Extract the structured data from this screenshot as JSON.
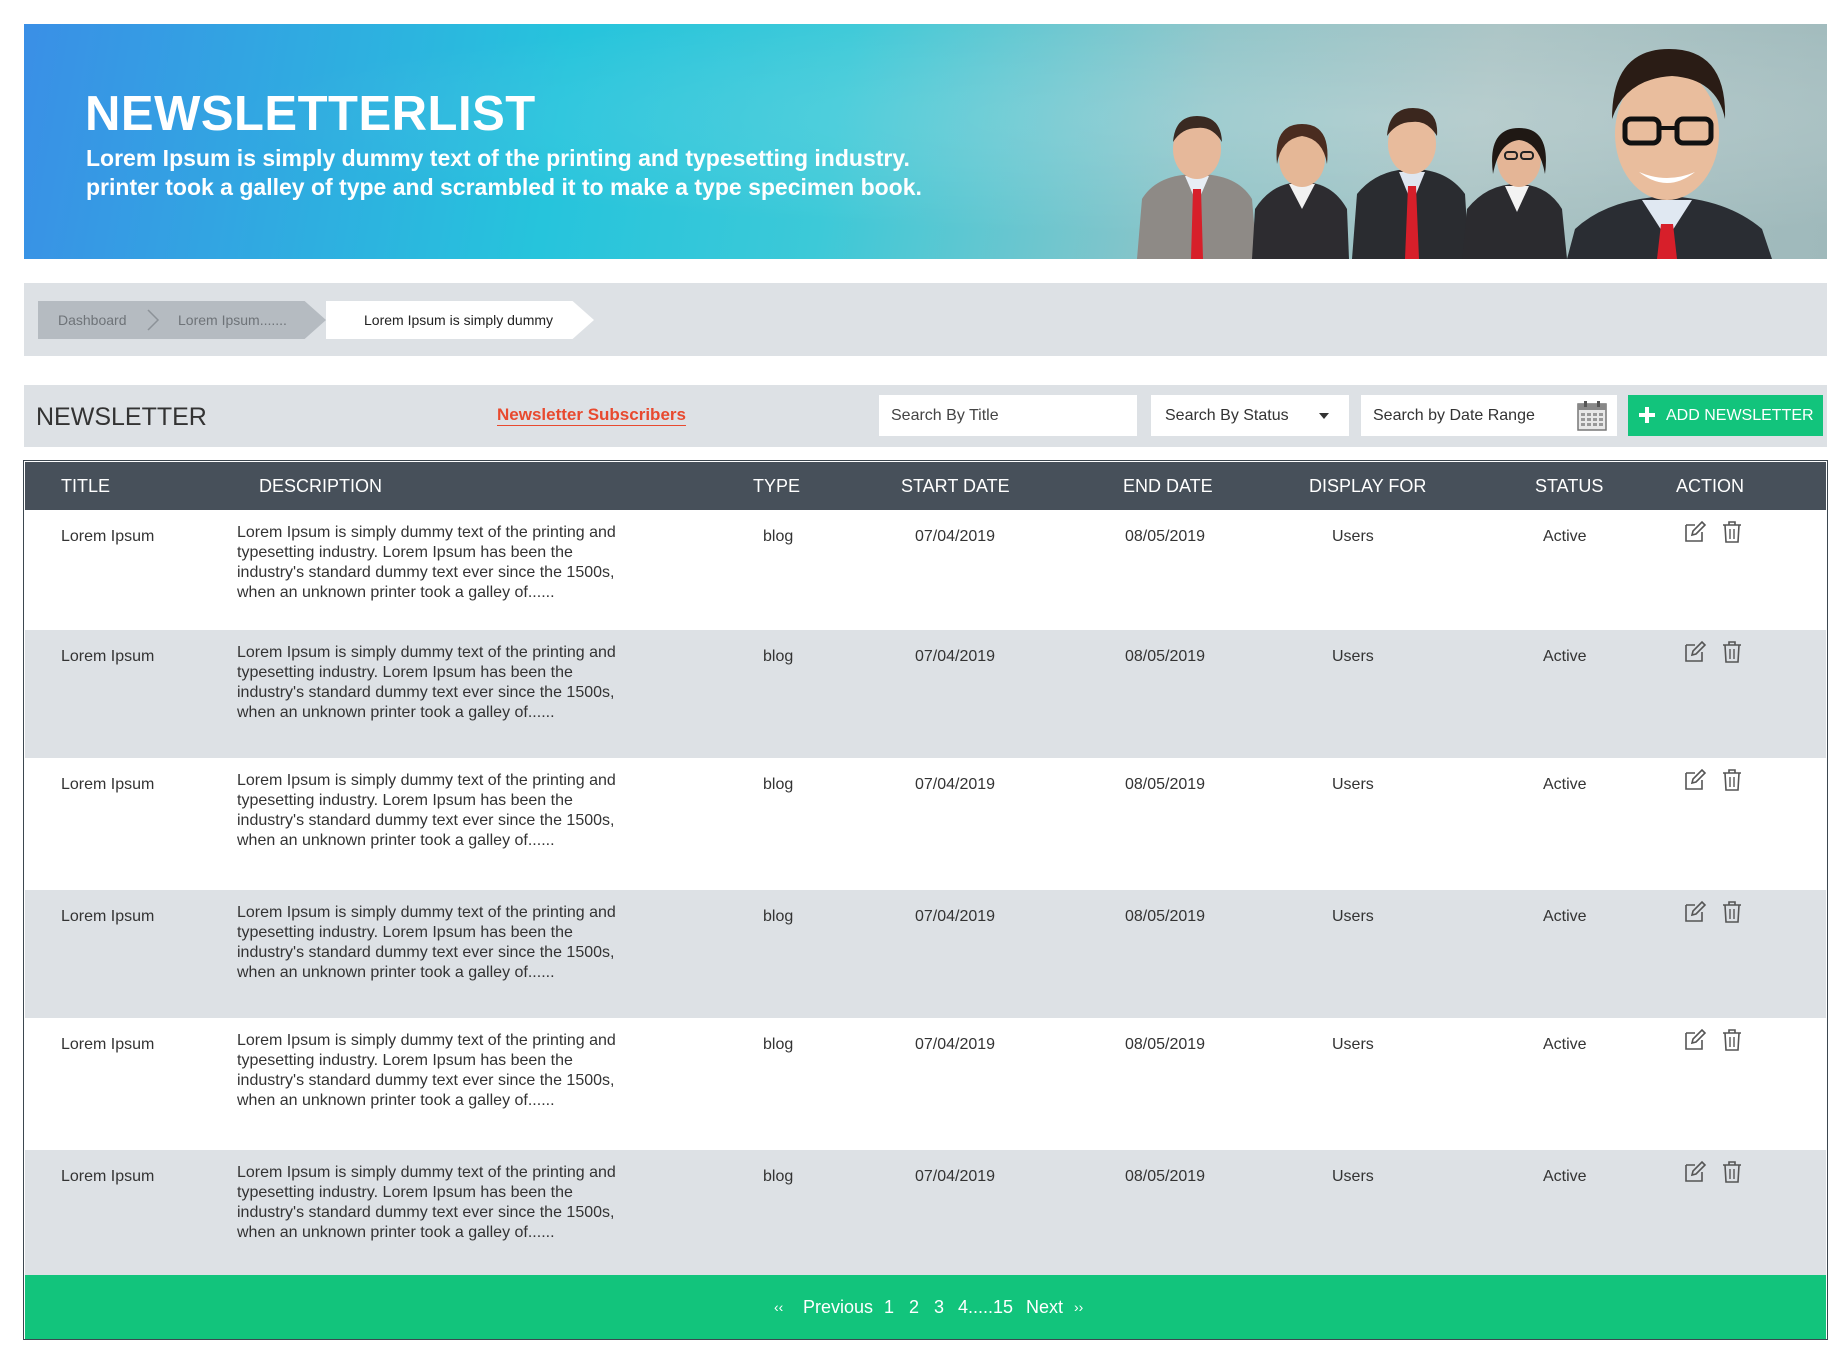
{
  "banner": {
    "title": "NEWSLETTERLIST",
    "subtitle_line1": "Lorem Ipsum is simply dummy text of the printing and typesetting industry.",
    "subtitle_line2": "printer took a galley of type and scrambled it to make a type specimen book."
  },
  "breadcrumb": {
    "items": [
      "Dashboard",
      "Lorem Ipsum.......",
      "Lorem Ipsum is simply dummy text"
    ]
  },
  "toolbar": {
    "title": "NEWSLETTER",
    "subscribers_link": "Newsletter Subscribers",
    "search_title_placeholder": "Search By Title",
    "search_status_value": "Search By Status",
    "search_date_placeholder": "Search by Date Range",
    "add_label": "ADD NEWSLETTER"
  },
  "table": {
    "columns": [
      "TITLE",
      "DESCRIPTION",
      "TYPE",
      "START DATE",
      "END DATE",
      "DISPLAY FOR",
      "STATUS",
      "ACTION"
    ],
    "rows": [
      {
        "title": "Lorem Ipsum",
        "desc": [
          "Lorem Ipsum is simply dummy text of the printing and",
          "typesetting industry. Lorem Ipsum has been the",
          "industry's standard dummy text ever since the 1500s,",
          "when an unknown printer took a galley of......"
        ],
        "type": "blog",
        "start": "07/04/2019",
        "end": "08/05/2019",
        "display": "Users",
        "status": "Active"
      },
      {
        "title": "Lorem Ipsum",
        "desc": [
          "Lorem Ipsum is simply dummy text of the printing and",
          "typesetting industry. Lorem Ipsum has been the",
          "industry's standard dummy text ever since the 1500s,",
          "when an unknown printer took a galley of......"
        ],
        "type": "blog",
        "start": "07/04/2019",
        "end": "08/05/2019",
        "display": "Users",
        "status": "Active"
      },
      {
        "title": "Lorem Ipsum",
        "desc": [
          "Lorem Ipsum is simply dummy text of the printing and",
          "typesetting industry. Lorem Ipsum has been the",
          "industry's standard dummy text ever since the 1500s,",
          "when an unknown printer took a galley of......"
        ],
        "type": "blog",
        "start": "07/04/2019",
        "end": "08/05/2019",
        "display": "Users",
        "status": "Active"
      },
      {
        "title": "Lorem Ipsum",
        "desc": [
          "Lorem Ipsum is simply dummy text of the printing and",
          "typesetting industry. Lorem Ipsum has been the",
          "industry's standard dummy text ever since the 1500s,",
          "when an unknown printer took a galley of......"
        ],
        "type": "blog",
        "start": "07/04/2019",
        "end": "08/05/2019",
        "display": "Users",
        "status": "Active"
      },
      {
        "title": "Lorem Ipsum",
        "desc": [
          "Lorem Ipsum is simply dummy text of the printing and",
          "typesetting industry. Lorem Ipsum has been the",
          "industry's standard dummy text ever since the 1500s,",
          "when an unknown printer took a galley of......"
        ],
        "type": "blog",
        "start": "07/04/2019",
        "end": "08/05/2019",
        "display": "Users",
        "status": "Active"
      },
      {
        "title": "Lorem Ipsum",
        "desc": [
          "Lorem Ipsum is simply dummy text of the printing and",
          "typesetting industry. Lorem Ipsum has been the",
          "industry's standard dummy text ever since the 1500s,",
          "when an unknown printer took a galley of......"
        ],
        "type": "blog",
        "start": "07/04/2019",
        "end": "08/05/2019",
        "display": "Users",
        "status": "Active"
      }
    ],
    "action_icons": [
      "edit-icon",
      "trash-icon"
    ]
  },
  "pagination": {
    "first": "‹‹",
    "previous": "Previous",
    "pages": [
      "1",
      "2",
      "3",
      "4.....15"
    ],
    "next": "Next",
    "last": "››"
  },
  "colors": {
    "accent_green": "#12c47c",
    "link_red": "#e84a2f",
    "header_dark": "#47505a",
    "panel_gray": "#dde1e5"
  }
}
